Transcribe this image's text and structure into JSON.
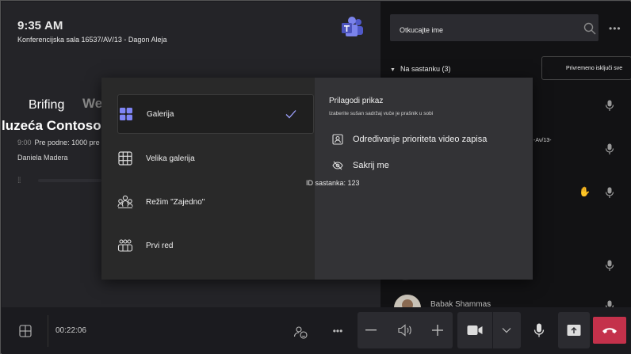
{
  "clock": {
    "time": "9:35",
    "ampm": "AM"
  },
  "room_name": "Konferencijska sala 16537/AV/13 - Dagon Aleja",
  "meeting": {
    "title_a": "Brifing",
    "title_b": "We",
    "title_c": "luzeća Contoso",
    "time_dim": "9:00",
    "time_text": "Pre podne: 1000 pre podne",
    "host": "Daniela Madera"
  },
  "side": {
    "search_placeholder": "Otkucajte ime",
    "section_header": "Na sastanku (3)",
    "mute_all_label": "Privremeno isključi sve",
    "room_fragment": "-Av/13-",
    "participant_name": "Babak Shammas"
  },
  "popup": {
    "layouts": [
      {
        "label": "Galerija",
        "icon": "gallery-icon",
        "selected": true
      },
      {
        "label": "Velika galerija",
        "icon": "large-gallery-icon",
        "selected": false
      },
      {
        "label": "Režim \"Zajedno\"",
        "icon": "together-mode-icon",
        "selected": false
      },
      {
        "label": "Prvi red",
        "icon": "front-row-icon",
        "selected": false
      }
    ],
    "customize_title": "Prilagodi prikaz",
    "customize_subtitle": "Izaberite sušan sadržaj vuče je prašnik u sobi",
    "prioritize_label": "Određivanje prioriteta video zapisa",
    "hide_me_label": "Sakrij me",
    "meeting_id": "ID sastanka: 123"
  },
  "toolbar": {
    "timer": "00:22:06"
  },
  "colors": {
    "hangup": "#c4314b",
    "accent": "#7f85f5",
    "hand": "#e0a030"
  }
}
